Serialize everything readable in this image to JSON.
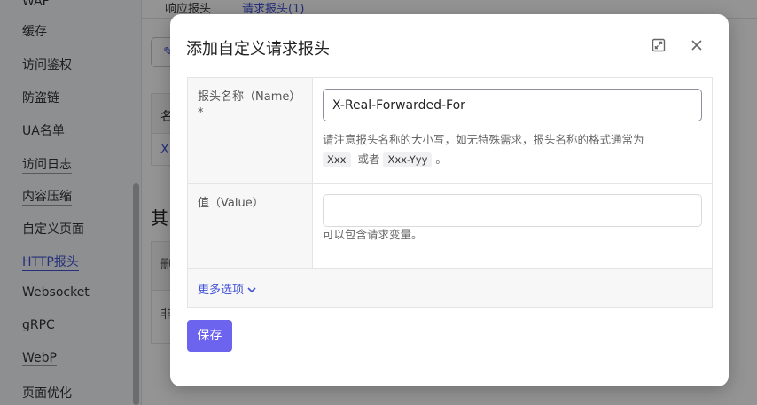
{
  "sidebar": {
    "items": [
      {
        "label": "WAF",
        "state": "normal"
      },
      {
        "label": "缓存",
        "state": "normal"
      },
      {
        "label": "访问鉴权",
        "state": "normal"
      },
      {
        "label": "防盗链",
        "state": "normal"
      },
      {
        "label": "UA名单",
        "state": "normal"
      },
      {
        "label": "访问日志",
        "state": "underlined"
      },
      {
        "label": "内容压缩",
        "state": "underlined"
      },
      {
        "label": "自定义页面",
        "state": "normal"
      },
      {
        "label": "HTTP报头",
        "state": "active"
      },
      {
        "label": "Websocket",
        "state": "normal"
      },
      {
        "label": "gRPC",
        "state": "normal"
      },
      {
        "label": "WebP",
        "state": "underlined"
      },
      {
        "label": "页面优化",
        "state": "normal"
      }
    ]
  },
  "page": {
    "tabs": [
      {
        "label": "响应报头"
      },
      {
        "label": "请求报头(1)"
      }
    ],
    "table_header_fragment": "名",
    "table_cell_fragment": "X",
    "section_heading_fragment": "其",
    "table2_header_fragment": "删",
    "table2_cell_fragment": "非"
  },
  "modal": {
    "title": "添加自定义请求报头",
    "fields": {
      "name": {
        "label": "报头名称（Name）",
        "required_mark": "*",
        "value": "X-Real-Forwarded-For",
        "hint_text": "请注意报头名称的大小写，如无特殊需求，报头名称的格式通常为",
        "hint_example1": "Xxx",
        "hint_or": "或者",
        "hint_example2": "Xxx-Yyy",
        "hint_end": "。"
      },
      "value": {
        "label": "值（Value）",
        "value": "",
        "hint": "可以包含请求变量。"
      }
    },
    "more_options": "更多选项",
    "save_label": "保存"
  },
  "colors": {
    "accent": "#4052d6",
    "primary_button": "#6c63ee"
  }
}
